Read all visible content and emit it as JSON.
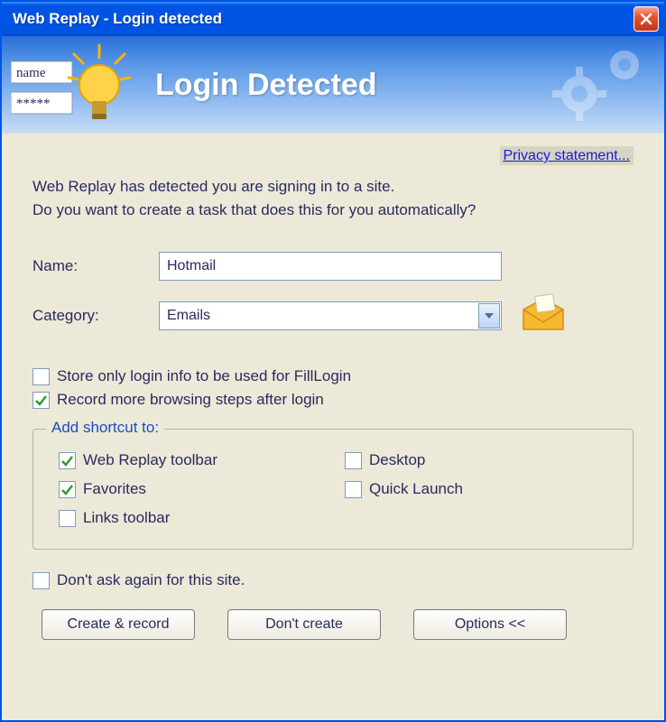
{
  "window": {
    "title": "Web Replay - Login detected"
  },
  "banner": {
    "title": "Login Detected",
    "name_field_sample": "name",
    "password_field_sample": "*****"
  },
  "privacy": {
    "label": "Privacy statement..."
  },
  "message": {
    "line1": "Web Replay has detected you are signing in to a site.",
    "line2": "Do you want to create a task that does this for you automatically?"
  },
  "form": {
    "name_label": "Name:",
    "name_value": "Hotmail",
    "category_label": "Category:",
    "category_value": "Emails"
  },
  "checks": {
    "store_only": {
      "label": "Store only login info to be used for FillLogin",
      "checked": false
    },
    "record_more": {
      "label": "Record more browsing steps after login",
      "checked": true
    }
  },
  "shortcuts": {
    "legend": "Add shortcut to:",
    "items": {
      "toolbar": {
        "label": "Web Replay toolbar",
        "checked": true
      },
      "desktop": {
        "label": "Desktop",
        "checked": false
      },
      "favorites": {
        "label": "Favorites",
        "checked": true
      },
      "quicklaunch": {
        "label": "Quick Launch",
        "checked": false
      },
      "links": {
        "label": "Links toolbar",
        "checked": false
      }
    }
  },
  "dont_ask": {
    "label": "Don't ask again for this site.",
    "checked": false
  },
  "buttons": {
    "create": "Create & record",
    "dont": "Don't create",
    "options": "Options <<"
  }
}
